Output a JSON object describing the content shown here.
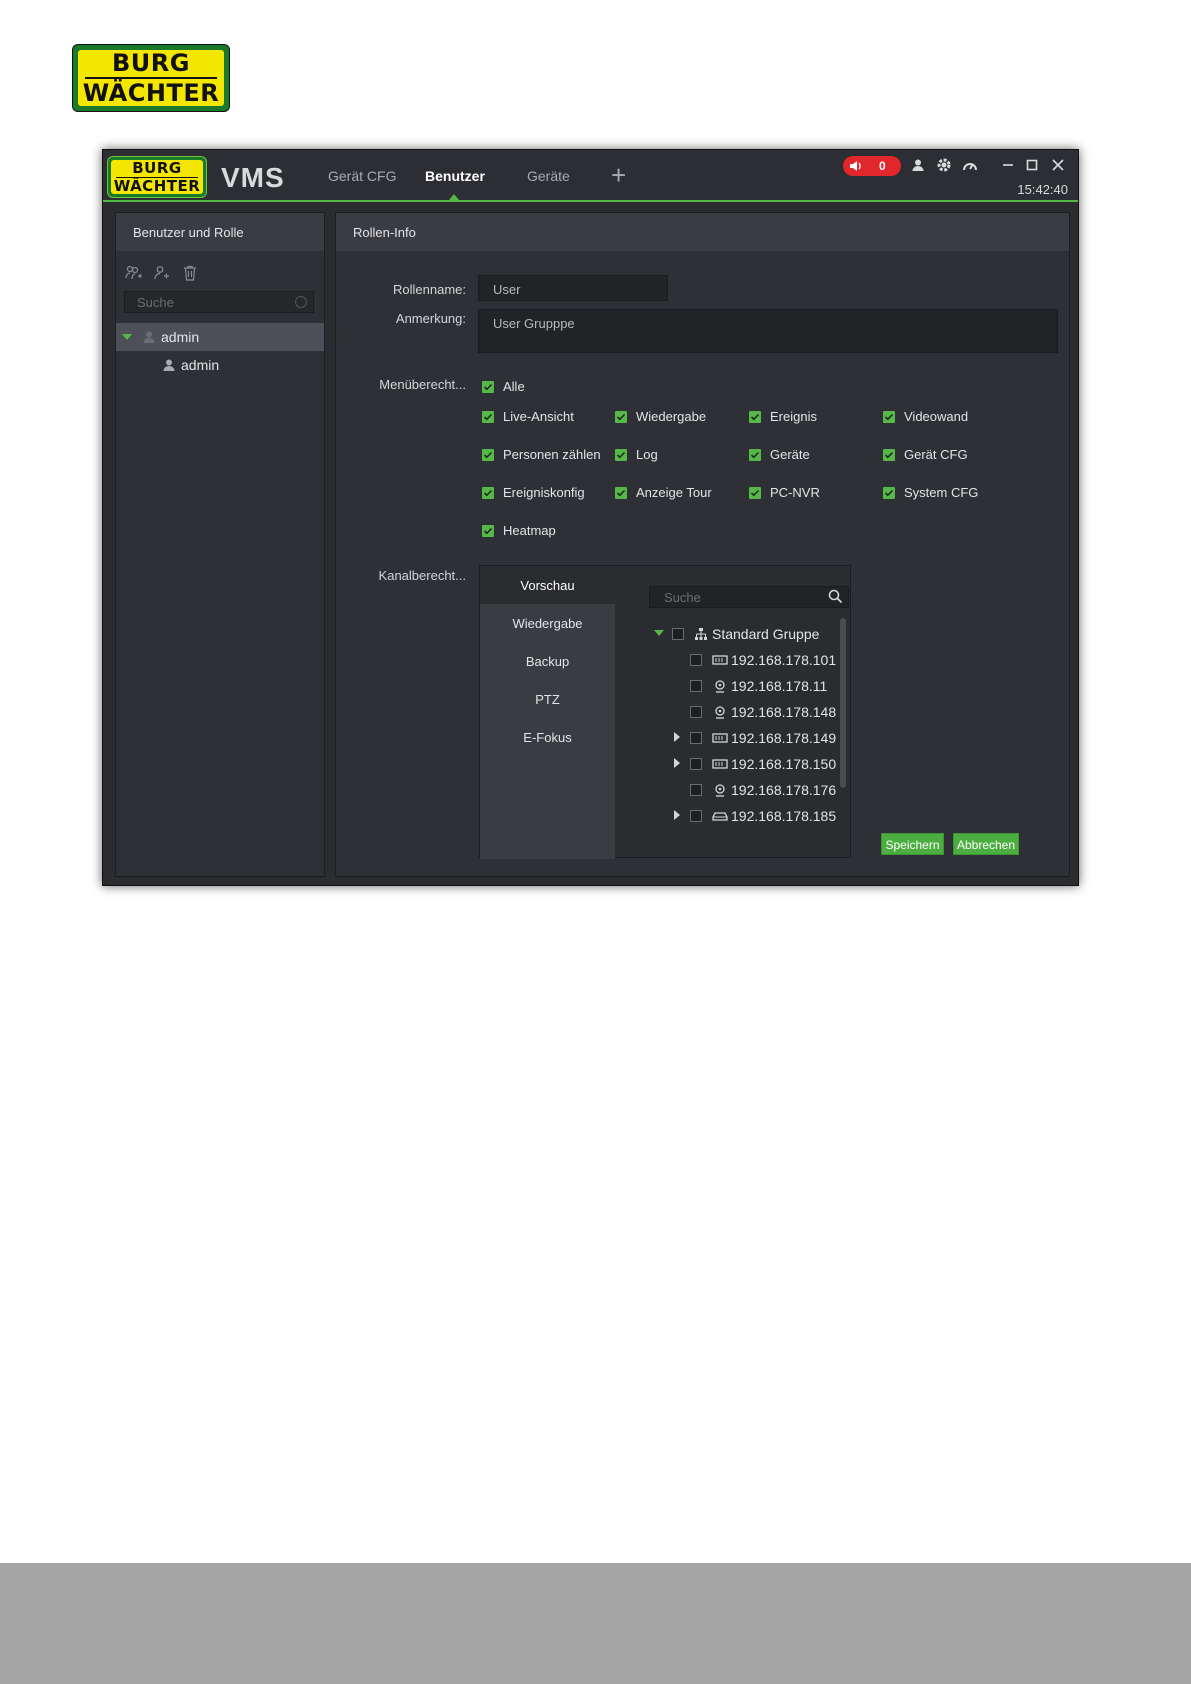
{
  "logo": {
    "line1": "BURG",
    "line2": "WÄCHTER"
  },
  "app": {
    "name": "VMS",
    "time": "15:42:40",
    "alarm_count": "0"
  },
  "tabs": [
    {
      "label": "Gerät CFG"
    },
    {
      "label": "Benutzer"
    },
    {
      "label": "Geräte"
    }
  ],
  "left": {
    "title": "Benutzer und Rolle",
    "search_placeholder": "Suche",
    "tree": [
      {
        "label": "admin"
      },
      {
        "label": "admin"
      }
    ]
  },
  "right": {
    "title": "Rollen-Info",
    "rolename_label": "Rollenname:",
    "rolename_value": "User",
    "note_label": "Anmerkung:",
    "note_value": "User Grupppe",
    "menu_label": "Menüberecht...",
    "menu_all": "Alle",
    "menu_items": [
      "Live-Ansicht",
      "Wiedergabe",
      "Ereignis",
      "Videowand",
      "Personen zählen",
      "Log",
      "Geräte",
      "Gerät CFG",
      "Ereigniskonfig",
      "Anzeige Tour",
      "PC-NVR",
      "System CFG",
      "Heatmap"
    ],
    "channel_label": "Kanalberecht...",
    "channel_tabs": [
      "Vorschau",
      "Wiedergabe",
      "Backup",
      "PTZ",
      "E-Fokus"
    ],
    "channel_search_placeholder": "Suche",
    "group_name": "Standard Gruppe",
    "devices": [
      "192.168.178.101",
      "192.168.178.11",
      "192.168.178.148",
      "192.168.178.149",
      "192.168.178.150",
      "192.168.178.176",
      "192.168.178.185"
    ],
    "save": "Speichern",
    "cancel": "Abbrechen"
  },
  "colors": {
    "accent": "#55b848",
    "alarm": "#e1272b",
    "logo_yellow": "#f3e600"
  }
}
